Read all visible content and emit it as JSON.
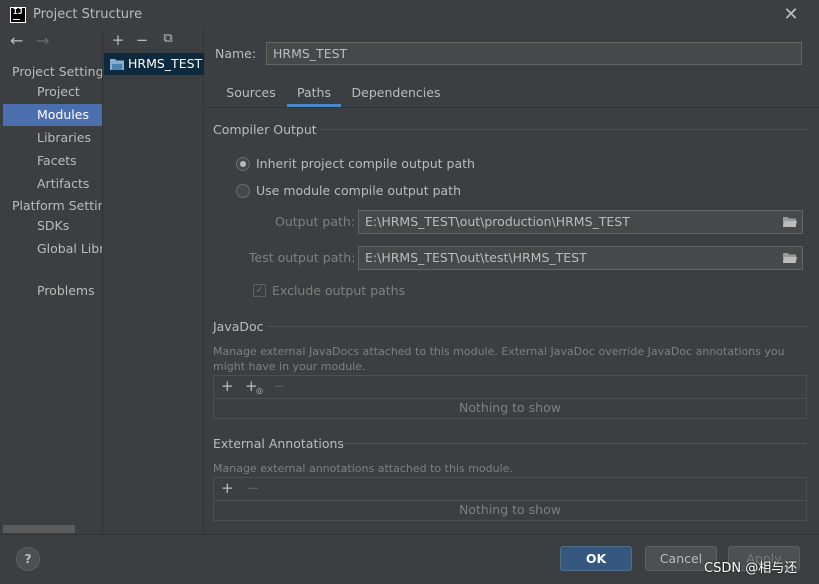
{
  "window": {
    "title": "Project Structure",
    "logo": "IJ"
  },
  "nav": {
    "back_icon": "←",
    "forward_icon": "→",
    "project_settings_label": "Project Settings",
    "project_settings_items": [
      {
        "label": "Project"
      },
      {
        "label": "Modules",
        "selected": true
      },
      {
        "label": "Libraries"
      },
      {
        "label": "Facets"
      },
      {
        "label": "Artifacts"
      }
    ],
    "platform_settings_label": "Platform Settings",
    "platform_settings_items": [
      {
        "label": "SDKs"
      },
      {
        "label": "Global Libraries"
      }
    ],
    "problems_label": "Problems"
  },
  "modules": {
    "add_icon": "+",
    "remove_icon": "−",
    "copy_icon": "⧉",
    "items": [
      {
        "label": "HRMS_TEST"
      }
    ]
  },
  "main": {
    "name_label": "Name:",
    "name_value": "HRMS_TEST",
    "tabs": [
      {
        "label": "Sources"
      },
      {
        "label": "Paths",
        "active": true
      },
      {
        "label": "Dependencies"
      }
    ],
    "compiler_output": {
      "title": "Compiler Output",
      "inherit_label": "Inherit project compile output path",
      "use_module_label": "Use module compile output path",
      "selected": "inherit",
      "output_path_label": "Output path:",
      "output_path_value": "E:\\HRMS_TEST\\out\\production\\HRMS_TEST",
      "test_output_path_label": "Test output path:",
      "test_output_path_value": "E:\\HRMS_TEST\\out\\test\\HRMS_TEST",
      "exclude_label": "Exclude output paths",
      "exclude_checked": true
    },
    "javadoc": {
      "title": "JavaDoc",
      "description": "Manage external JavaDocs attached to this module. External JavaDoc override JavaDoc annotations you might have in your module.",
      "add_icon": "+",
      "add_url_icon": "+",
      "remove_icon": "−",
      "empty_text": "Nothing to show"
    },
    "external_annotations": {
      "title": "External Annotations",
      "description": "Manage external annotations attached to this module.",
      "add_icon": "+",
      "remove_icon": "−",
      "empty_text": "Nothing to show"
    }
  },
  "footer": {
    "help_label": "?",
    "ok_label": "OK",
    "cancel_label": "Cancel",
    "apply_label": "Apply",
    "watermark": "CSDN @相与还"
  },
  "colors": {
    "background": "#3c3f41",
    "selection": "#4b6eaf",
    "module_selection": "#0d293e",
    "ok_button": "#365880",
    "tab_underline": "#4a88c7"
  }
}
